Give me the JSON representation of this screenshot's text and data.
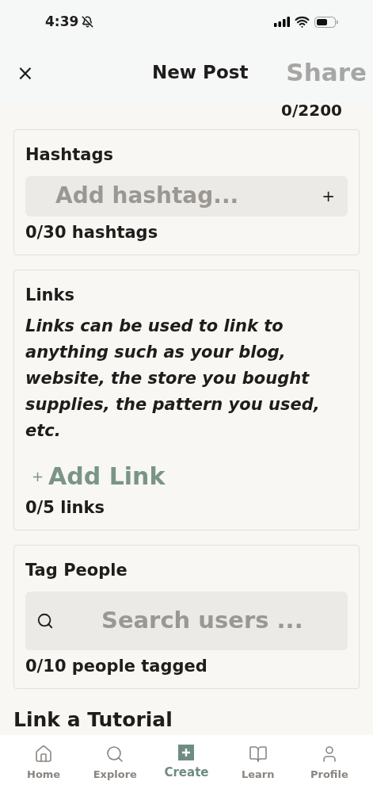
{
  "status_bar": {
    "time": "4:39"
  },
  "header": {
    "close": "×",
    "title": "New Post",
    "share": {
      "label": "Share",
      "disabled": true
    }
  },
  "caption_counter": "0/2200",
  "hashtags": {
    "title": "Hashtags",
    "placeholder": "Add hashtag...",
    "add": "+",
    "counter": "0/30 hashtags"
  },
  "links": {
    "title": "Links",
    "description": "Links can be used to link to anything such as your blog, website, the store you bought supplies, the pattern you used, etc.",
    "add_icon": "+",
    "add_label": "Add Link",
    "counter": "0/5 links"
  },
  "tag_people": {
    "title": "Tag People",
    "placeholder": "Search users ...",
    "counter": "0/10 people tagged"
  },
  "tutorial": {
    "title": "Link a Tutorial"
  },
  "tab_bar": [
    {
      "kind": "home",
      "label": "Home",
      "selected": false
    },
    {
      "kind": "explore",
      "label": "Explore",
      "selected": false
    },
    {
      "kind": "create",
      "label": "Create",
      "selected": true
    },
    {
      "kind": "learn",
      "label": "Learn",
      "selected": false
    },
    {
      "kind": "profile",
      "label": "Profile",
      "selected": false
    }
  ]
}
